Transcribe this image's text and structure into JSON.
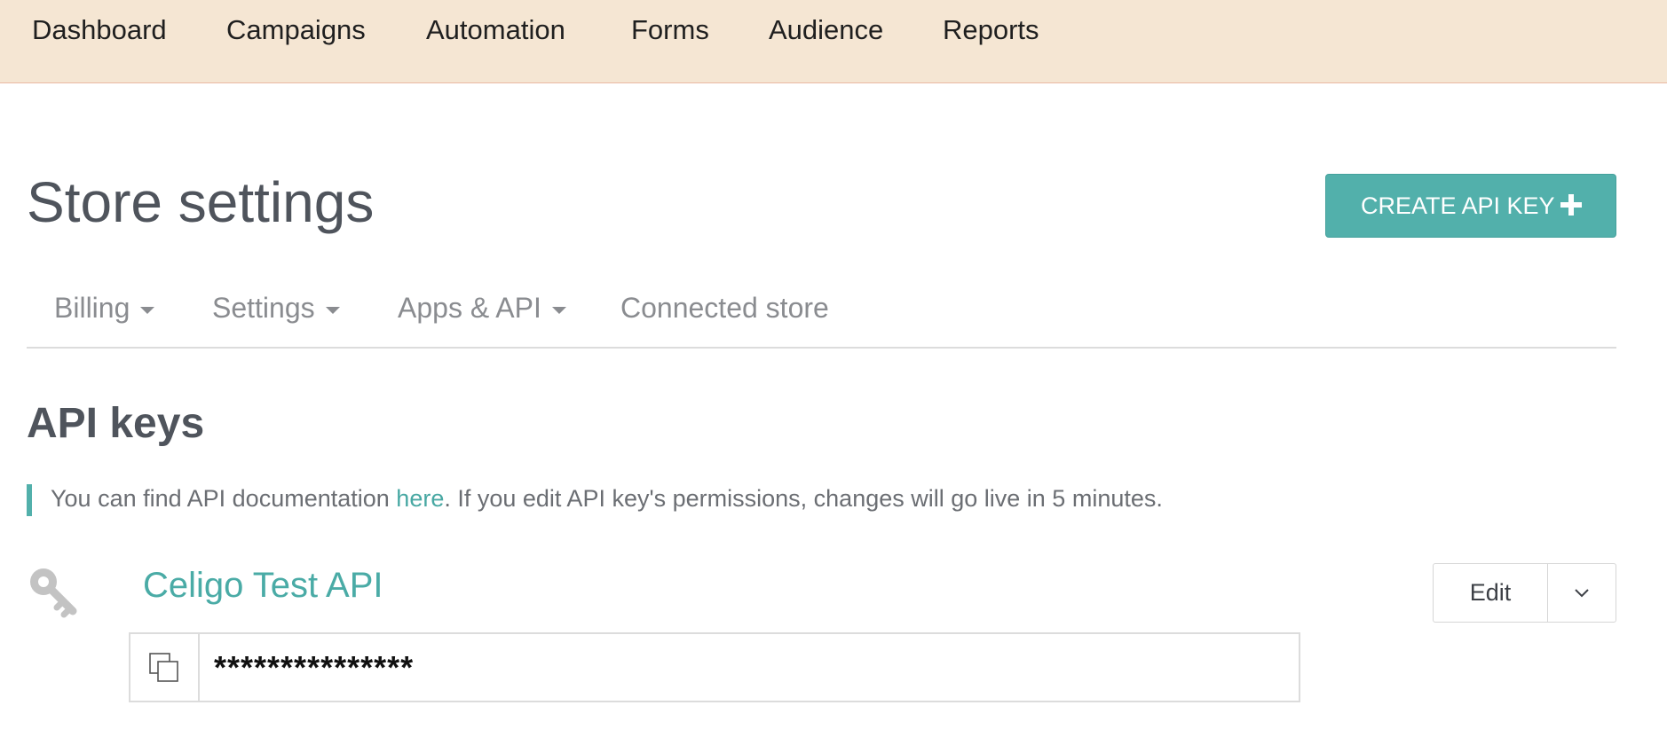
{
  "topnav": {
    "items": [
      "Dashboard",
      "Campaigns",
      "Automation",
      "Forms",
      "Audience",
      "Reports"
    ]
  },
  "header": {
    "title": "Store settings",
    "create_button_label": "CREATE API KEY",
    "create_button_icon": "plus-icon"
  },
  "subtabs": {
    "items": [
      {
        "label": "Billing",
        "has_dropdown": true
      },
      {
        "label": "Settings",
        "has_dropdown": true
      },
      {
        "label": "Apps & API",
        "has_dropdown": true
      },
      {
        "label": "Connected store",
        "has_dropdown": false
      }
    ]
  },
  "api_keys": {
    "section_title": "API keys",
    "notice_before": "You can find API documentation ",
    "notice_link": "here",
    "notice_after": ". If you edit API key's permissions, changes will go live in 5 minutes.",
    "items": [
      {
        "name": "Celigo Test API",
        "masked_key": "***************",
        "edit_label": "Edit",
        "icon": "key-icon"
      }
    ]
  },
  "colors": {
    "topnav_bg": "#f5e6d3",
    "accent": "#52b0ab",
    "link": "#48a8a3"
  }
}
